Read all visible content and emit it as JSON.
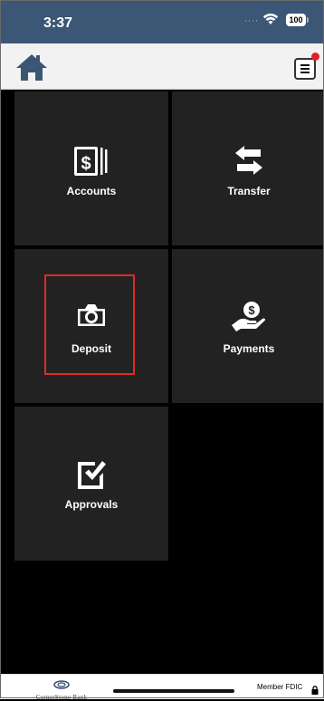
{
  "status_bar": {
    "time": "3:37",
    "battery": "100",
    "signal_text": "∙∙∙∙"
  },
  "header": {
    "home_icon": "house-icon",
    "menu_icon": "hamburger-menu-icon",
    "notification_color": "#e0202a"
  },
  "tiles": [
    {
      "label": "Accounts",
      "icon": "dollar-bill-icon"
    },
    {
      "label": "Transfer",
      "icon": "transfer-arrows-icon"
    },
    {
      "label": "Deposit",
      "icon": "camera-icon"
    },
    {
      "label": "Payments",
      "icon": "hand-coin-icon"
    },
    {
      "label": "Approvals",
      "icon": "checkbox-icon"
    }
  ],
  "highlight_color": "#e02a2a",
  "footer": {
    "bank_name": "CornerStone Bank",
    "member_text": "Member FDIC"
  },
  "colors": {
    "status_bar": "#3c5675",
    "tile": "#222222",
    "background": "#000000",
    "home_icon": "#3a5673"
  }
}
